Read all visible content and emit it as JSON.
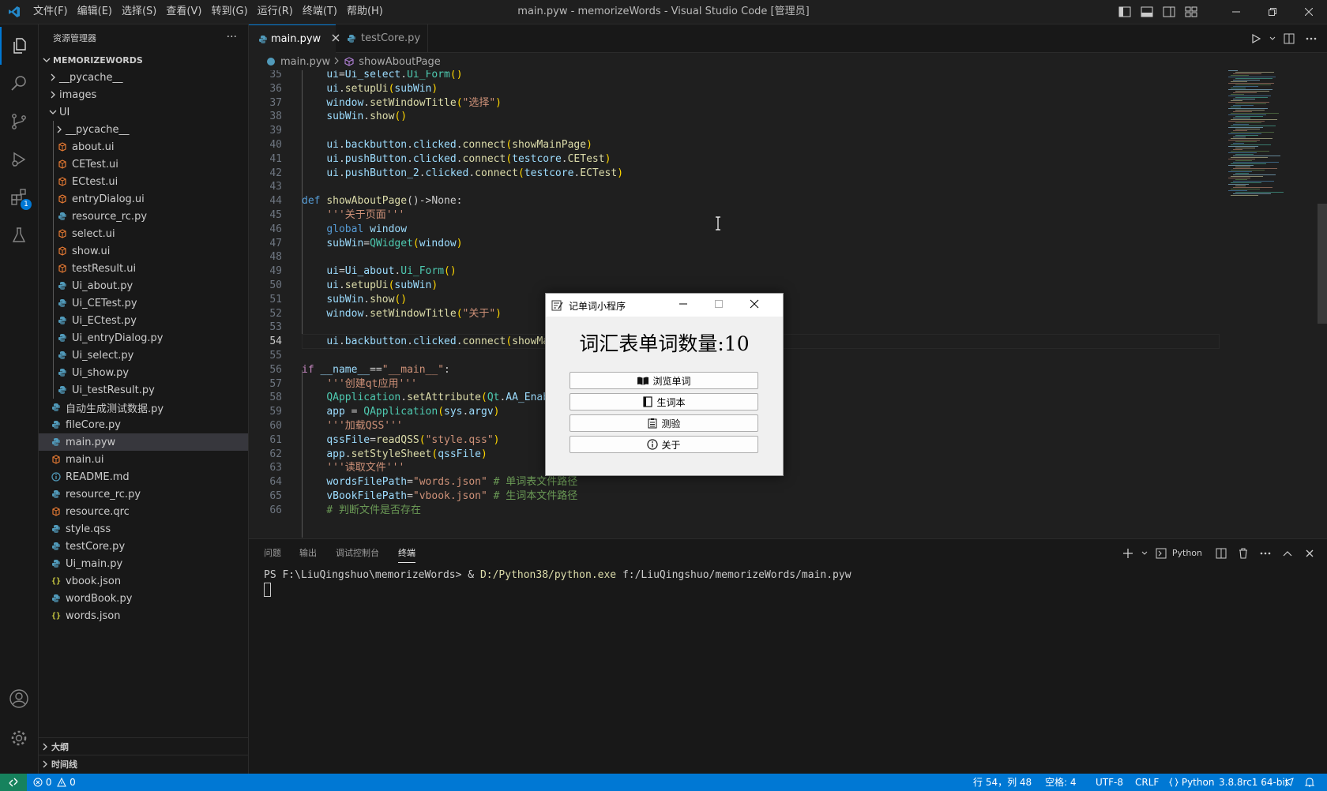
{
  "window": {
    "title": "main.pyw - memorizeWords - Visual Studio Code [管理员]"
  },
  "menu": [
    "文件(F)",
    "编辑(E)",
    "选择(S)",
    "查看(V)",
    "转到(G)",
    "运行(R)",
    "终端(T)",
    "帮助(H)"
  ],
  "activity": {
    "extensions_badge": "1"
  },
  "explorer": {
    "title": "资源管理器",
    "more": "···",
    "root": "MEMORIZEWORDS",
    "items": [
      {
        "label": "__pycache__",
        "kind": "folder",
        "expanded": false,
        "indent": 1
      },
      {
        "label": "images",
        "kind": "folder",
        "expanded": false,
        "indent": 1
      },
      {
        "label": "UI",
        "kind": "folder",
        "expanded": true,
        "indent": 1
      },
      {
        "label": "__pycache__",
        "kind": "folder",
        "expanded": false,
        "indent": 2
      },
      {
        "label": "about.ui",
        "kind": "ui",
        "indent": 2
      },
      {
        "label": "CETest.ui",
        "kind": "ui",
        "indent": 2
      },
      {
        "label": "ECtest.ui",
        "kind": "ui",
        "indent": 2
      },
      {
        "label": "entryDialog.ui",
        "kind": "ui",
        "indent": 2
      },
      {
        "label": "resource_rc.py",
        "kind": "py",
        "indent": 2
      },
      {
        "label": "select.ui",
        "kind": "ui",
        "indent": 2
      },
      {
        "label": "show.ui",
        "kind": "ui",
        "indent": 2
      },
      {
        "label": "testResult.ui",
        "kind": "ui",
        "indent": 2
      },
      {
        "label": "Ui_about.py",
        "kind": "py",
        "indent": 2
      },
      {
        "label": "Ui_CETest.py",
        "kind": "py",
        "indent": 2
      },
      {
        "label": "Ui_ECtest.py",
        "kind": "py",
        "indent": 2
      },
      {
        "label": "Ui_entryDialog.py",
        "kind": "py",
        "indent": 2
      },
      {
        "label": "Ui_select.py",
        "kind": "py",
        "indent": 2
      },
      {
        "label": "Ui_show.py",
        "kind": "py",
        "indent": 2
      },
      {
        "label": "Ui_testResult.py",
        "kind": "py",
        "indent": 2
      },
      {
        "label": "自动生成测试数据.py",
        "kind": "py",
        "indent": 1
      },
      {
        "label": "fileCore.py",
        "kind": "py",
        "indent": 1
      },
      {
        "label": "main.pyw",
        "kind": "py",
        "indent": 1,
        "selected": true
      },
      {
        "label": "main.ui",
        "kind": "ui",
        "indent": 1
      },
      {
        "label": "README.md",
        "kind": "md",
        "indent": 1
      },
      {
        "label": "resource_rc.py",
        "kind": "py",
        "indent": 1
      },
      {
        "label": "resource.qrc",
        "kind": "ui",
        "indent": 1
      },
      {
        "label": "style.qss",
        "kind": "py",
        "indent": 1
      },
      {
        "label": "testCore.py",
        "kind": "py",
        "indent": 1
      },
      {
        "label": "Ui_main.py",
        "kind": "py",
        "indent": 1
      },
      {
        "label": "vbook.json",
        "kind": "json",
        "indent": 1
      },
      {
        "label": "wordBook.py",
        "kind": "py",
        "indent": 1
      },
      {
        "label": "words.json",
        "kind": "json",
        "indent": 1
      }
    ],
    "outline": "大纲",
    "timeline": "时间线"
  },
  "tabs": [
    {
      "label": "main.pyw",
      "active": true
    },
    {
      "label": "testCore.py",
      "active": false
    }
  ],
  "breadcrumb": {
    "file": "main.pyw",
    "symbol": "showAboutPage"
  },
  "current_line": 54,
  "code": [
    {
      "n": "35",
      "t": [
        {
          "s": "    ",
          "c": "w"
        },
        {
          "s": "ui",
          "c": "v"
        },
        {
          "s": "=",
          "c": "w"
        },
        {
          "s": "Ui_select",
          "c": "v"
        },
        {
          "s": ".",
          "c": "w"
        },
        {
          "s": "Ui_Form",
          "c": "t"
        },
        {
          "s": "()",
          "c": "y"
        }
      ]
    },
    {
      "n": "36",
      "t": [
        {
          "s": "    ",
          "c": "w"
        },
        {
          "s": "ui",
          "c": "v"
        },
        {
          "s": ".",
          "c": "w"
        },
        {
          "s": "setupUi",
          "c": "f"
        },
        {
          "s": "(",
          "c": "y"
        },
        {
          "s": "subWin",
          "c": "v"
        },
        {
          "s": ")",
          "c": "y"
        }
      ]
    },
    {
      "n": "37",
      "t": [
        {
          "s": "    ",
          "c": "w"
        },
        {
          "s": "window",
          "c": "v"
        },
        {
          "s": ".",
          "c": "w"
        },
        {
          "s": "setWindowTitle",
          "c": "f"
        },
        {
          "s": "(",
          "c": "y"
        },
        {
          "s": "\"选择\"",
          "c": "s"
        },
        {
          "s": ")",
          "c": "y"
        }
      ]
    },
    {
      "n": "38",
      "t": [
        {
          "s": "    ",
          "c": "w"
        },
        {
          "s": "subWin",
          "c": "v"
        },
        {
          "s": ".",
          "c": "w"
        },
        {
          "s": "show",
          "c": "f"
        },
        {
          "s": "()",
          "c": "y"
        }
      ]
    },
    {
      "n": "39",
      "t": []
    },
    {
      "n": "40",
      "t": [
        {
          "s": "    ",
          "c": "w"
        },
        {
          "s": "ui",
          "c": "v"
        },
        {
          "s": ".",
          "c": "w"
        },
        {
          "s": "backbutton",
          "c": "v"
        },
        {
          "s": ".",
          "c": "w"
        },
        {
          "s": "clicked",
          "c": "v"
        },
        {
          "s": ".",
          "c": "w"
        },
        {
          "s": "connect",
          "c": "f"
        },
        {
          "s": "(",
          "c": "y"
        },
        {
          "s": "showMainPage",
          "c": "f"
        },
        {
          "s": ")",
          "c": "y"
        }
      ]
    },
    {
      "n": "41",
      "t": [
        {
          "s": "    ",
          "c": "w"
        },
        {
          "s": "ui",
          "c": "v"
        },
        {
          "s": ".",
          "c": "w"
        },
        {
          "s": "pushButton",
          "c": "v"
        },
        {
          "s": ".",
          "c": "w"
        },
        {
          "s": "clicked",
          "c": "v"
        },
        {
          "s": ".",
          "c": "w"
        },
        {
          "s": "connect",
          "c": "f"
        },
        {
          "s": "(",
          "c": "y"
        },
        {
          "s": "testcore",
          "c": "v"
        },
        {
          "s": ".",
          "c": "w"
        },
        {
          "s": "CETest",
          "c": "f"
        },
        {
          "s": ")",
          "c": "y"
        }
      ]
    },
    {
      "n": "42",
      "t": [
        {
          "s": "    ",
          "c": "w"
        },
        {
          "s": "ui",
          "c": "v"
        },
        {
          "s": ".",
          "c": "w"
        },
        {
          "s": "pushButton_2",
          "c": "v"
        },
        {
          "s": ".",
          "c": "w"
        },
        {
          "s": "clicked",
          "c": "v"
        },
        {
          "s": ".",
          "c": "w"
        },
        {
          "s": "connect",
          "c": "f"
        },
        {
          "s": "(",
          "c": "y"
        },
        {
          "s": "testcore",
          "c": "v"
        },
        {
          "s": ".",
          "c": "w"
        },
        {
          "s": "ECTest",
          "c": "f"
        },
        {
          "s": ")",
          "c": "y"
        }
      ]
    },
    {
      "n": "43",
      "t": []
    },
    {
      "n": "44",
      "t": [
        {
          "s": "def ",
          "c": "k"
        },
        {
          "s": "showAboutPage",
          "c": "f"
        },
        {
          "s": "()->None:",
          "c": "w"
        }
      ]
    },
    {
      "n": "45",
      "t": [
        {
          "s": "    ",
          "c": "w"
        },
        {
          "s": "'''关于页面'''",
          "c": "s"
        }
      ]
    },
    {
      "n": "46",
      "t": [
        {
          "s": "    ",
          "c": "w"
        },
        {
          "s": "global ",
          "c": "k"
        },
        {
          "s": "window",
          "c": "v"
        }
      ]
    },
    {
      "n": "47",
      "t": [
        {
          "s": "    ",
          "c": "w"
        },
        {
          "s": "subWin",
          "c": "v"
        },
        {
          "s": "=",
          "c": "w"
        },
        {
          "s": "QWidget",
          "c": "t"
        },
        {
          "s": "(",
          "c": "y"
        },
        {
          "s": "window",
          "c": "v"
        },
        {
          "s": ")",
          "c": "y"
        }
      ]
    },
    {
      "n": "48",
      "t": []
    },
    {
      "n": "49",
      "t": [
        {
          "s": "    ",
          "c": "w"
        },
        {
          "s": "ui",
          "c": "v"
        },
        {
          "s": "=",
          "c": "w"
        },
        {
          "s": "Ui_about",
          "c": "v"
        },
        {
          "s": ".",
          "c": "w"
        },
        {
          "s": "Ui_Form",
          "c": "t"
        },
        {
          "s": "()",
          "c": "y"
        }
      ]
    },
    {
      "n": "50",
      "t": [
        {
          "s": "    ",
          "c": "w"
        },
        {
          "s": "ui",
          "c": "v"
        },
        {
          "s": ".",
          "c": "w"
        },
        {
          "s": "setupUi",
          "c": "f"
        },
        {
          "s": "(",
          "c": "y"
        },
        {
          "s": "subWin",
          "c": "v"
        },
        {
          "s": ")",
          "c": "y"
        }
      ]
    },
    {
      "n": "51",
      "t": [
        {
          "s": "    ",
          "c": "w"
        },
        {
          "s": "subWin",
          "c": "v"
        },
        {
          "s": ".",
          "c": "w"
        },
        {
          "s": "show",
          "c": "f"
        },
        {
          "s": "()",
          "c": "y"
        }
      ]
    },
    {
      "n": "52",
      "t": [
        {
          "s": "    ",
          "c": "w"
        },
        {
          "s": "window",
          "c": "v"
        },
        {
          "s": ".",
          "c": "w"
        },
        {
          "s": "setWindowTitle",
          "c": "f"
        },
        {
          "s": "(",
          "c": "y"
        },
        {
          "s": "\"关于\"",
          "c": "s"
        },
        {
          "s": ")",
          "c": "y"
        }
      ]
    },
    {
      "n": "53",
      "t": []
    },
    {
      "n": "54",
      "t": [
        {
          "s": "    ",
          "c": "w"
        },
        {
          "s": "ui",
          "c": "v"
        },
        {
          "s": ".",
          "c": "w"
        },
        {
          "s": "backbutton",
          "c": "v"
        },
        {
          "s": ".",
          "c": "w"
        },
        {
          "s": "clicked",
          "c": "v"
        },
        {
          "s": ".",
          "c": "w"
        },
        {
          "s": "connect",
          "c": "f"
        },
        {
          "s": "(",
          "c": "y"
        },
        {
          "s": "showMa",
          "c": "f"
        }
      ]
    },
    {
      "n": "55",
      "t": []
    },
    {
      "n": "56",
      "t": [
        {
          "s": "if ",
          "c": "p"
        },
        {
          "s": "__name__",
          "c": "v"
        },
        {
          "s": "==",
          "c": "w"
        },
        {
          "s": "\"__main__\"",
          "c": "s"
        },
        {
          "s": ":",
          "c": "w"
        }
      ]
    },
    {
      "n": "57",
      "t": [
        {
          "s": "    ",
          "c": "w"
        },
        {
          "s": "'''创建qt应用'''",
          "c": "s"
        }
      ]
    },
    {
      "n": "58",
      "t": [
        {
          "s": "    ",
          "c": "w"
        },
        {
          "s": "QApplication",
          "c": "t"
        },
        {
          "s": ".",
          "c": "w"
        },
        {
          "s": "setAttribute",
          "c": "f"
        },
        {
          "s": "(",
          "c": "y"
        },
        {
          "s": "Qt",
          "c": "t"
        },
        {
          "s": ".",
          "c": "w"
        },
        {
          "s": "AA_Enab",
          "c": "v"
        }
      ]
    },
    {
      "n": "59",
      "t": [
        {
          "s": "    ",
          "c": "w"
        },
        {
          "s": "app",
          "c": "v"
        },
        {
          "s": " = ",
          "c": "w"
        },
        {
          "s": "QApplication",
          "c": "t"
        },
        {
          "s": "(",
          "c": "y"
        },
        {
          "s": "sys",
          "c": "v"
        },
        {
          "s": ".",
          "c": "w"
        },
        {
          "s": "argv",
          "c": "v"
        },
        {
          "s": ")",
          "c": "y"
        }
      ]
    },
    {
      "n": "60",
      "t": [
        {
          "s": "    ",
          "c": "w"
        },
        {
          "s": "'''加载QSS'''",
          "c": "s"
        }
      ]
    },
    {
      "n": "61",
      "t": [
        {
          "s": "    ",
          "c": "w"
        },
        {
          "s": "qssFile",
          "c": "v"
        },
        {
          "s": "=",
          "c": "w"
        },
        {
          "s": "readQSS",
          "c": "f"
        },
        {
          "s": "(",
          "c": "y"
        },
        {
          "s": "\"style.qss\"",
          "c": "s"
        },
        {
          "s": ")",
          "c": "y"
        }
      ]
    },
    {
      "n": "62",
      "t": [
        {
          "s": "    ",
          "c": "w"
        },
        {
          "s": "app",
          "c": "v"
        },
        {
          "s": ".",
          "c": "w"
        },
        {
          "s": "setStyleSheet",
          "c": "f"
        },
        {
          "s": "(",
          "c": "y"
        },
        {
          "s": "qssFile",
          "c": "v"
        },
        {
          "s": ")",
          "c": "y"
        }
      ]
    },
    {
      "n": "63",
      "t": [
        {
          "s": "    ",
          "c": "w"
        },
        {
          "s": "'''读取文件'''",
          "c": "s"
        }
      ]
    },
    {
      "n": "64",
      "t": [
        {
          "s": "    ",
          "c": "w"
        },
        {
          "s": "wordsFilePath",
          "c": "v"
        },
        {
          "s": "=",
          "c": "w"
        },
        {
          "s": "\"words.json\"",
          "c": "s"
        },
        {
          "s": " # 单词表文件路径",
          "c": "g"
        }
      ]
    },
    {
      "n": "65",
      "t": [
        {
          "s": "    ",
          "c": "w"
        },
        {
          "s": "vBookFilePath",
          "c": "v"
        },
        {
          "s": "=",
          "c": "w"
        },
        {
          "s": "\"vbook.json\"",
          "c": "s"
        },
        {
          "s": " # 生词本文件路径",
          "c": "g"
        }
      ]
    },
    {
      "n": "66",
      "t": [
        {
          "s": "    ",
          "c": "w"
        },
        {
          "s": "# 判断文件是否存在",
          "c": "g"
        }
      ]
    }
  ],
  "colors": {
    "w": "#cccccc",
    "v": "#9cdcfe",
    "f": "#dcdcaa",
    "t": "#4ec9b0",
    "s": "#ce9178",
    "k": "#569cd6",
    "p": "#c586c0",
    "y": "#ffd700",
    "g": "#6a9955",
    "accent": "#0078d4"
  },
  "panel": {
    "tabs": [
      "问题",
      "输出",
      "调试控制台",
      "终端"
    ],
    "active_tab": "终端",
    "shell": "Python",
    "prompt": "PS F:\\LiuQingshuo\\memorizeWords> & ",
    "exe": "D:/Python38/python.exe",
    "arg": " f:/LiuQingshuo/memorizeWords/main.pyw"
  },
  "status": {
    "errors": "0",
    "warnings": "0",
    "position": "行 54，列 48",
    "spaces": "空格: 4",
    "encoding": "UTF-8",
    "eol": "CRLF",
    "language": "Python",
    "interpreter": "3.8.8rc1 64-bit"
  },
  "dialog": {
    "title": "记单词小程序",
    "heading": "词汇表单词数量:10",
    "buttons": [
      {
        "label": "浏览单词",
        "icon": "open-book-icon"
      },
      {
        "label": "生词本",
        "icon": "notebook-icon"
      },
      {
        "label": "测验",
        "icon": "clipboard-icon"
      },
      {
        "label": "关于",
        "icon": "info-icon"
      }
    ]
  }
}
